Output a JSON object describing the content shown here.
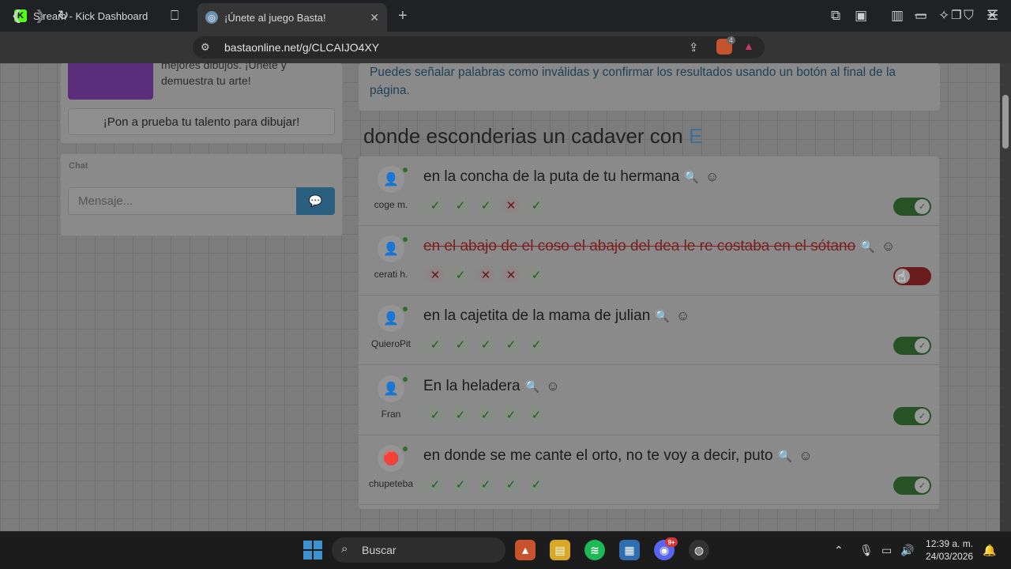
{
  "browser": {
    "tabs": [
      {
        "title": "Stream - Kick Dashboard",
        "active": false
      },
      {
        "title": "¡Únete al juego Basta!",
        "active": true
      }
    ],
    "url": "bastaonline.net/g/CLCAIJO4XY",
    "brave_badge": "4"
  },
  "sidebar": {
    "promo_text": "mejores dibujos. ¡Únete y demuestra tu arte!",
    "promo_button": "¡Pon a prueba tu talento para dibujar!",
    "chat_label": "Chat",
    "chat_placeholder": "Mensaje..."
  },
  "main": {
    "info": "Puedes señalar palabras como inválidas y confirmar los resultados usando un botón al final de la página.",
    "question_text": "donde esconderias un cadaver con",
    "question_letter": "E",
    "answers": [
      {
        "user": "coge m.",
        "text": "en la concha de la puta de tu hermana",
        "votes": [
          "ok",
          "ok",
          "ok",
          "no",
          "ok"
        ],
        "valid": true
      },
      {
        "user": "cerati h.",
        "text": "en el abajo de el coso el abajo del dea le re costaba en el sótano",
        "votes": [
          "no",
          "ok",
          "no",
          "no",
          "ok"
        ],
        "valid": false
      },
      {
        "user": "QuieroPit",
        "text": "en la cajetita de la mama de julian",
        "votes": [
          "ok",
          "ok",
          "ok",
          "ok",
          "ok"
        ],
        "valid": true
      },
      {
        "user": "Fran",
        "text": "En la heladera",
        "votes": [
          "ok",
          "ok",
          "ok",
          "ok",
          "ok"
        ],
        "valid": true
      },
      {
        "user": "chupeteba",
        "text": "en donde se me cante el orto, no te voy a decir, puto",
        "votes": [
          "ok",
          "ok",
          "ok",
          "ok",
          "ok"
        ],
        "valid": true
      }
    ]
  },
  "taskbar": {
    "search_placeholder": "Buscar",
    "discord_badge": "9+",
    "time": "12:39 a. m.",
    "date": "24/03/2026"
  }
}
